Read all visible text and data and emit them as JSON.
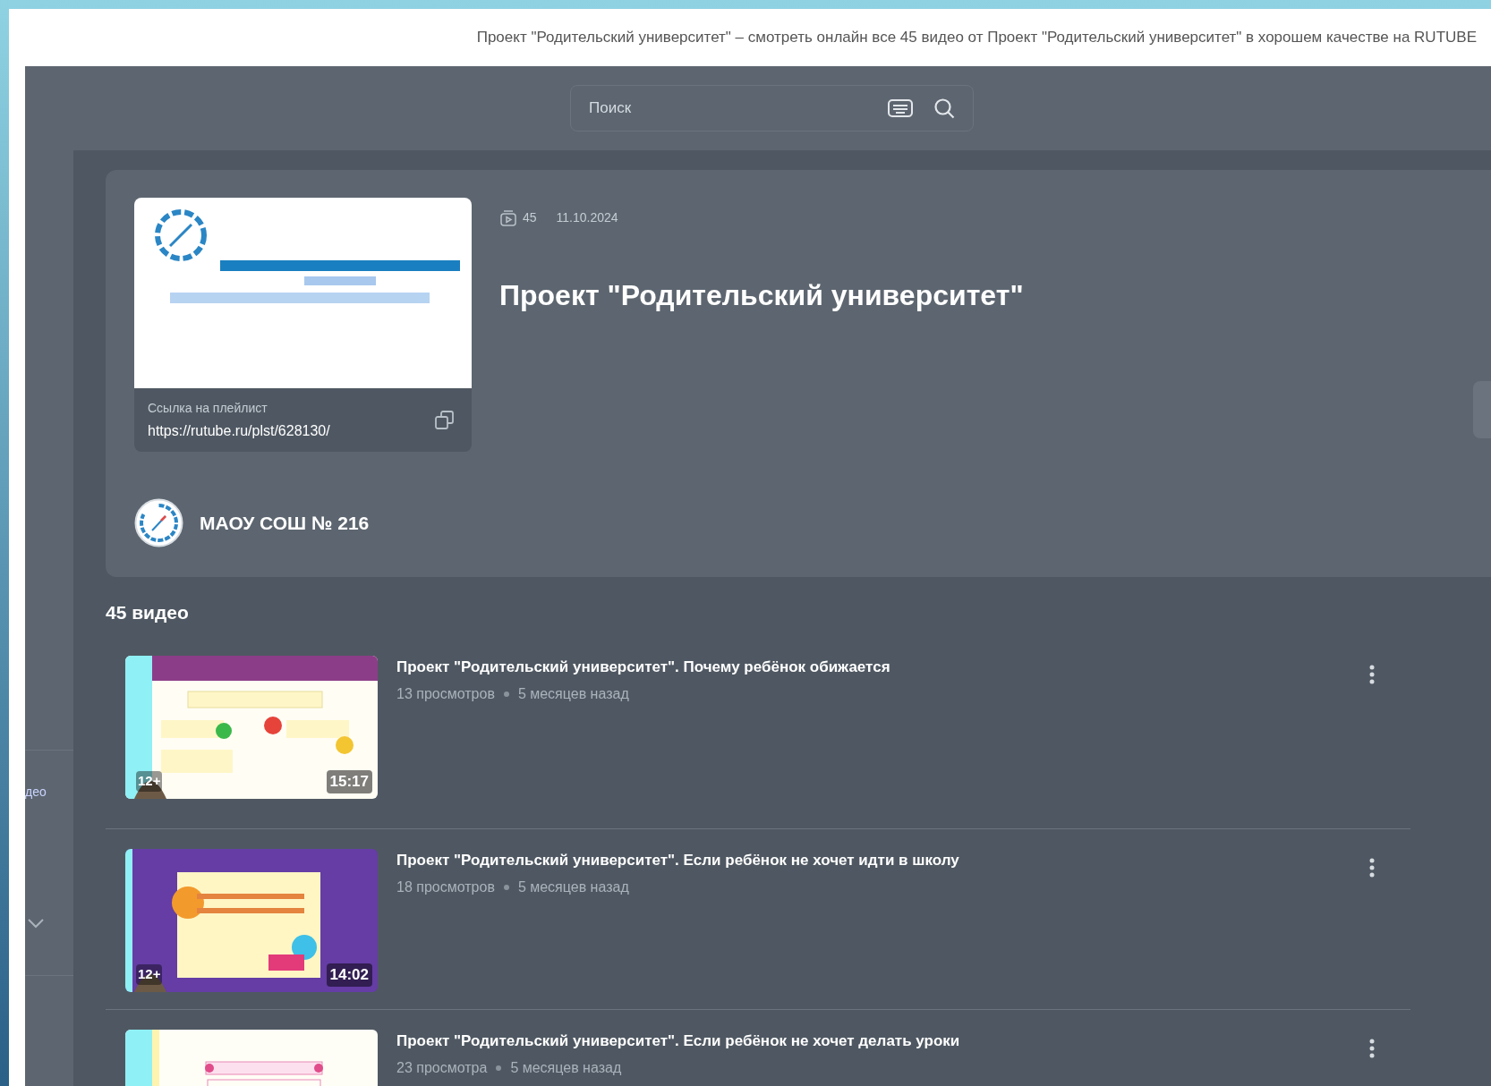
{
  "window": {
    "title": "Проект \"Родительский университет\" – смотреть онлайн все 45 видео от Проект \"Родительский университет\" в хорошем качестве на RUTUBE"
  },
  "search": {
    "placeholder": "Поиск"
  },
  "sidebar": {
    "items": [
      {
        "label": "део"
      }
    ]
  },
  "playlist": {
    "video_count": "45",
    "date": "11.10.2024",
    "title": "Проект \"Родительский университет\"",
    "link_label": "Ссылка на плейлист",
    "link": "https://rutube.ru/plst/628130/",
    "channel": "МАОУ СОШ № 216"
  },
  "list_heading": "45 видео",
  "videos": [
    {
      "title": "Проект \"Родительский университет\". Почему ребёнок обижается",
      "views": "13 просмотров",
      "age": "5 месяцев назад",
      "rating": "12+",
      "duration": "15:17"
    },
    {
      "title": "Проект \"Родительский университет\". Если ребёнок не хочет идти в школу",
      "views": "18 просмотров",
      "age": "5 месяцев назад",
      "rating": "12+",
      "duration": "14:02"
    },
    {
      "title": "Проект \"Родительский университет\". Если ребёнок не хочет делать уроки",
      "views": "23 просмотра",
      "age": "5 месяцев назад"
    }
  ]
}
